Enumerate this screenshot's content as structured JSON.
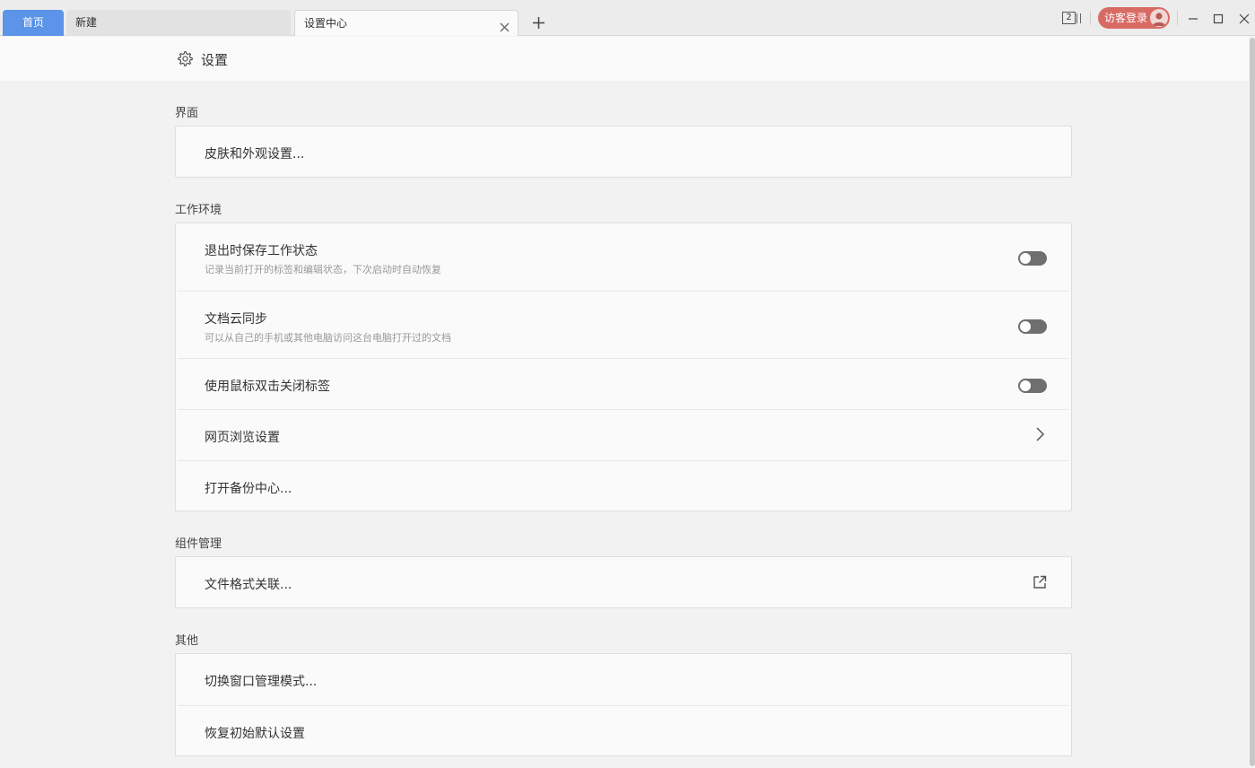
{
  "tabs": [
    {
      "label": "首页",
      "active": false
    },
    {
      "label": "新建",
      "active": false
    },
    {
      "label": "设置中心",
      "active": true
    }
  ],
  "window": {
    "tab_count": "2",
    "login_label": "访客登录"
  },
  "header": {
    "title": "设置"
  },
  "sections": {
    "appearance": {
      "title": "界面",
      "items": [
        {
          "label": "皮肤和外观设置..."
        }
      ]
    },
    "workspace": {
      "title": "工作环境",
      "items": [
        {
          "label": "退出时保存工作状态",
          "desc": "记录当前打开的标签和编辑状态，下次启动时自动恢复",
          "toggle": false
        },
        {
          "label": "文档云同步",
          "desc": "可以从自己的手机或其他电脑访问这台电脑打开过的文档",
          "toggle": false
        },
        {
          "label": "使用鼠标双击关闭标签",
          "toggle": false
        },
        {
          "label": "网页浏览设置"
        },
        {
          "label": "打开备份中心..."
        }
      ]
    },
    "components": {
      "title": "组件管理",
      "items": [
        {
          "label": "文件格式关联..."
        }
      ]
    },
    "other": {
      "title": "其他",
      "items": [
        {
          "label": "切换窗口管理模式..."
        },
        {
          "label": "恢复初始默认设置"
        }
      ]
    }
  },
  "colors": {
    "accent_tab": "#5b94e8",
    "login_button": "#d86a64",
    "toggle_off": "#6f6f6f"
  },
  "icons": {
    "header": "gear-icon",
    "tab_close": "close-icon",
    "tab_add": "plus-icon",
    "browse_settings": "chevron-right-icon",
    "file_assoc": "external-link-icon"
  }
}
